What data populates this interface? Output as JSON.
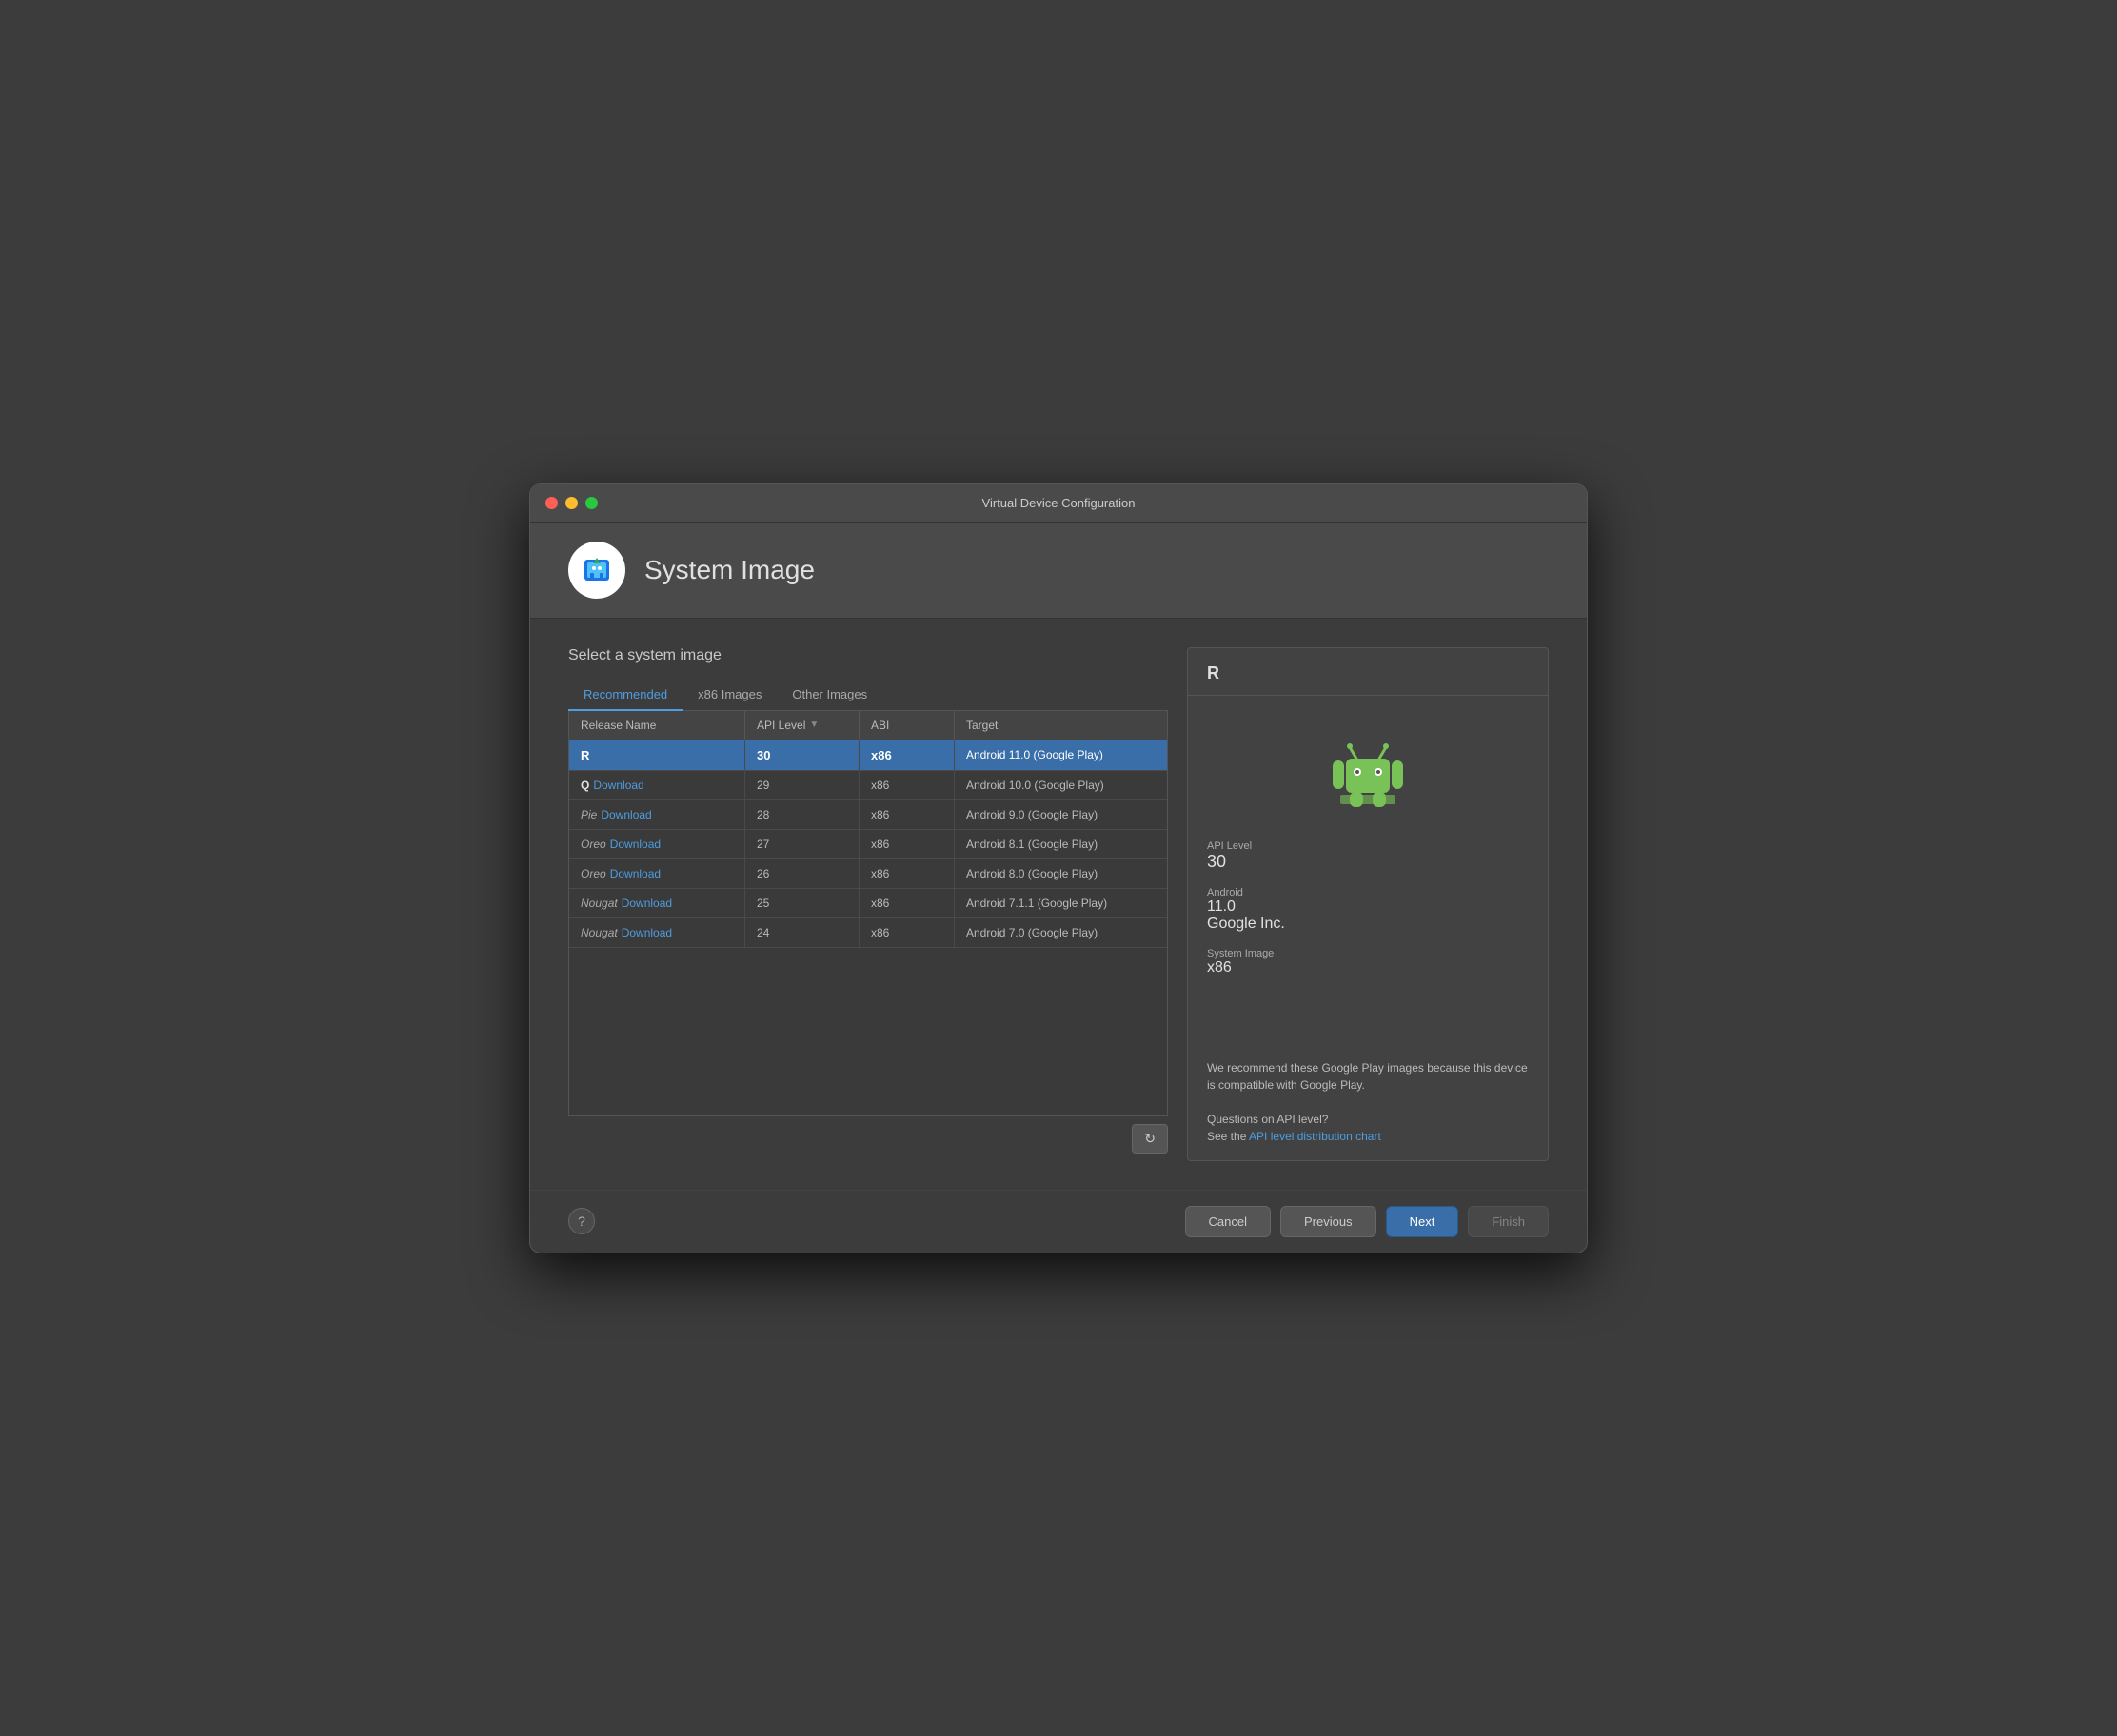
{
  "window": {
    "title": "Virtual Device Configuration"
  },
  "header": {
    "title": "System Image"
  },
  "content": {
    "section_title": "Select a system image",
    "tabs": [
      {
        "id": "recommended",
        "label": "Recommended",
        "active": true
      },
      {
        "id": "x86",
        "label": "x86 Images",
        "active": false
      },
      {
        "id": "other",
        "label": "Other Images",
        "active": false
      }
    ],
    "table": {
      "columns": [
        {
          "id": "release_name",
          "label": "Release Name"
        },
        {
          "id": "api_level",
          "label": "API Level",
          "sortable": true
        },
        {
          "id": "abi",
          "label": "ABI"
        },
        {
          "id": "target",
          "label": "Target"
        }
      ],
      "rows": [
        {
          "release_name_letter": "R",
          "release_name_download": "",
          "api_level": "30",
          "abi": "x86",
          "target": "Android 11.0 (Google Play)",
          "selected": true
        },
        {
          "release_name_letter": "Q",
          "release_name_download": "Download",
          "api_level": "29",
          "abi": "x86",
          "target": "Android 10.0 (Google Play)",
          "selected": false
        },
        {
          "release_name_letter": "Pie",
          "release_name_download": "Download",
          "api_level": "28",
          "abi": "x86",
          "target": "Android 9.0 (Google Play)",
          "selected": false
        },
        {
          "release_name_letter": "Oreo",
          "release_name_download": "Download",
          "api_level": "27",
          "abi": "x86",
          "target": "Android 8.1 (Google Play)",
          "selected": false
        },
        {
          "release_name_letter": "Oreo",
          "release_name_download": "Download",
          "api_level": "26",
          "abi": "x86",
          "target": "Android 8.0 (Google Play)",
          "selected": false
        },
        {
          "release_name_letter": "Nougat",
          "release_name_download": "Download",
          "api_level": "25",
          "abi": "x86",
          "target": "Android 7.1.1 (Google Play)",
          "selected": false
        },
        {
          "release_name_letter": "Nougat",
          "release_name_download": "Download",
          "api_level": "24",
          "abi": "x86",
          "target": "Android 7.0 (Google Play)",
          "selected": false
        }
      ]
    },
    "refresh_button_label": "↻"
  },
  "info_panel": {
    "release_name": "R",
    "api_level_label": "API Level",
    "api_level_value": "30",
    "android_label": "Android",
    "android_value": "11.0",
    "vendor_value": "Google Inc.",
    "system_image_label": "System Image",
    "system_image_value": "x86",
    "recommend_text": "We recommend these Google Play images because this device is compatible with Google Play.",
    "questions_text": "Questions on API level?",
    "see_the_text": "See the ",
    "api_link_text": "API level distribution chart"
  },
  "footer": {
    "help_label": "?",
    "cancel_label": "Cancel",
    "previous_label": "Previous",
    "next_label": "Next",
    "finish_label": "Finish"
  }
}
